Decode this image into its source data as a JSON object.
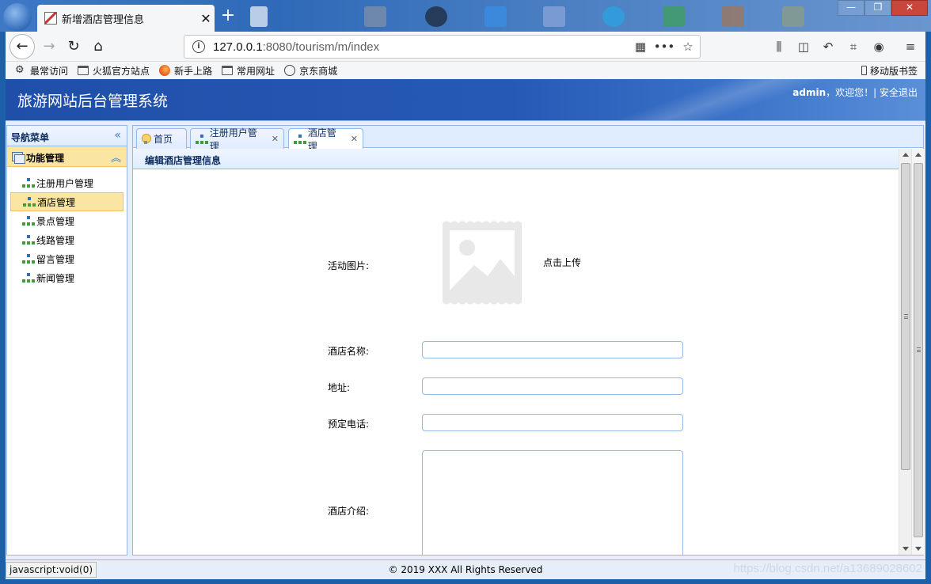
{
  "browser": {
    "tab_title": "新增酒店管理信息",
    "url_host": "127.0.0.1",
    "url_path": ":8080/tourism/m/index",
    "bookmarks": [
      "最常访问",
      "火狐官方站点",
      "新手上路",
      "常用网址",
      "京东商城"
    ],
    "mobile_bookmarks": "移动版书签",
    "status_url": "javascript:void(0)"
  },
  "header": {
    "app_title": "旅游网站后台管理系统",
    "user_name": "admin",
    "welcome": "，欢迎您！| ",
    "logout": "安全退出"
  },
  "sidebar": {
    "title": "导航菜单",
    "section": "功能管理",
    "items": [
      {
        "label": "注册用户管理"
      },
      {
        "label": "酒店管理"
      },
      {
        "label": "景点管理"
      },
      {
        "label": "线路管理"
      },
      {
        "label": "留言管理"
      },
      {
        "label": "新闻管理"
      }
    ]
  },
  "tabs": [
    {
      "label": "首页"
    },
    {
      "label": "注册用户管理"
    },
    {
      "label": "酒店管理"
    }
  ],
  "form": {
    "panel_title": "编辑酒店管理信息",
    "image_label": "活动图片:",
    "upload_text": "点击上传",
    "name_label": "酒店名称:",
    "name_value": "",
    "address_label": "地址:",
    "address_value": "",
    "phone_label": "预定电话:",
    "phone_value": "",
    "intro_label": "酒店介绍:",
    "intro_value": ""
  },
  "footer": {
    "copyright": "© 2019 XXX All Rights Reserved"
  },
  "watermark": "https://blog.csdn.net/a13689028602",
  "colors": {
    "header_blue": "#2659b6",
    "panel_border": "#95b8e7",
    "active_item": "#fbe5a3"
  }
}
